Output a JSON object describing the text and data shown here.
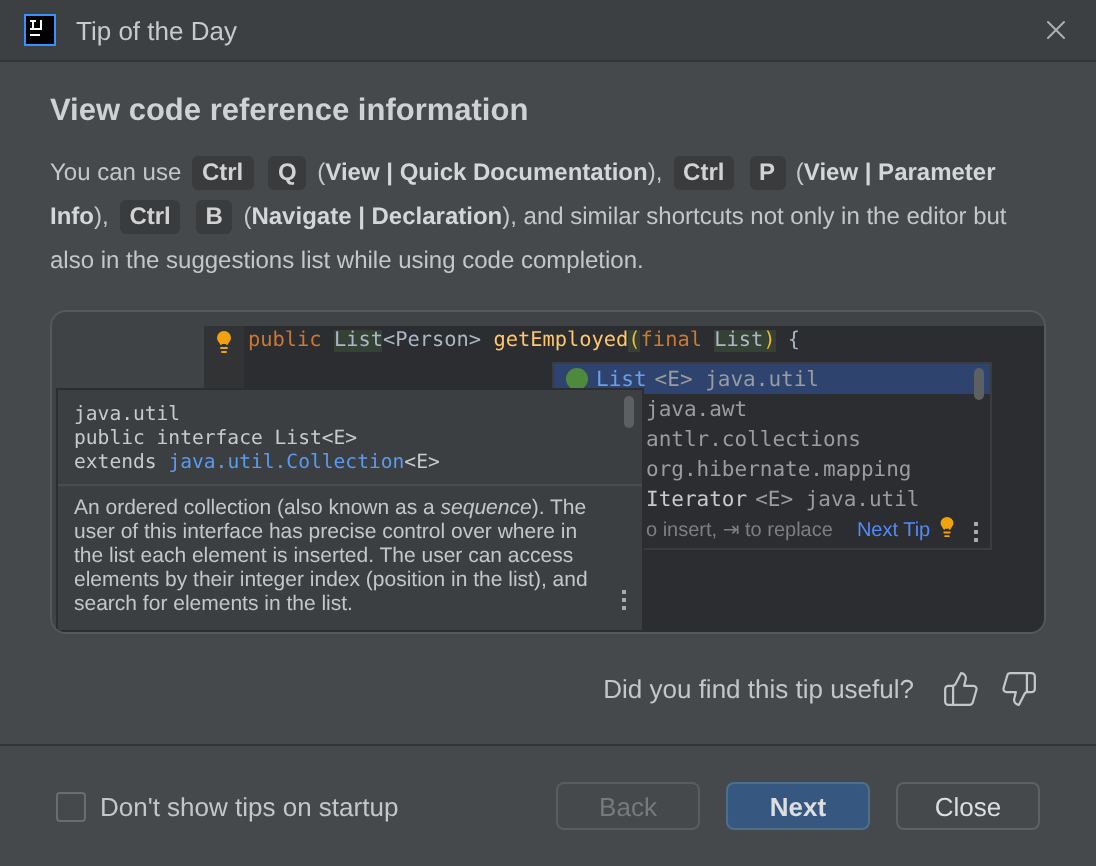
{
  "window": {
    "title": "Tip of the Day"
  },
  "tip": {
    "title": "View code reference information",
    "body": [
      {
        "kind": "text",
        "text": "You can use"
      },
      {
        "kind": "key",
        "text": "Ctrl"
      },
      {
        "kind": "key",
        "text": "Q"
      },
      {
        "kind": "text",
        "text": "(**View | Quick Documentation**),"
      },
      {
        "kind": "key",
        "text": "Ctrl"
      },
      {
        "kind": "key",
        "text": "P"
      },
      {
        "kind": "text",
        "text": "(**View | Parameter**"
      },
      {
        "kind": "text",
        "text": "**Info**),"
      },
      {
        "kind": "key",
        "text": "Ctrl"
      },
      {
        "kind": "key",
        "text": "B"
      },
      {
        "kind": "text",
        "text": "(**Navigate | Declaration**), and similar shortcuts not only in the editor but"
      },
      {
        "kind": "text",
        "text": "also in the suggestions list while using code completion."
      }
    ]
  },
  "example": {
    "code": [
      {
        "kind": "keyword",
        "text": "public "
      },
      {
        "kind": "type",
        "text": "List"
      },
      {
        "kind": "plain",
        "text": "<Person> "
      },
      {
        "kind": "method",
        "text": "getEmployed"
      },
      {
        "kind": "paren",
        "text": "("
      },
      {
        "kind": "keyword",
        "text": "final "
      },
      {
        "kind": "type",
        "text": "List"
      },
      {
        "kind": "paren",
        "text": ")"
      },
      {
        "kind": "plain",
        "text": " {"
      }
    ],
    "completion": {
      "items": [
        {
          "name": "List",
          "rest": "<E> java.util",
          "selected": true
        },
        {
          "rest": "java.awt",
          "selected": false
        },
        {
          "rest": "antlr.collections",
          "selected": false
        },
        {
          "rest": "org.hibernate.mapping",
          "selected": false
        },
        {
          "name": "Iterator",
          "rest": "<E> java.util",
          "selected": false
        }
      ],
      "hint": "o insert, ⇥ to replace",
      "link": "Next Tip"
    },
    "doc": {
      "lines": [
        "java.util",
        "public interface List<E>"
      ],
      "extends_label": "extends",
      "extends_link": "java.util.Collection",
      "extends_rest": "<E>",
      "description": "An ordered collection (also known as a *sequence*). The user of this interface has precise control over where in the list each element is inserted. The user can access elements by their integer index (position in the list), and search for elements in the list."
    }
  },
  "feedback": {
    "question": "Did you find this tip useful?"
  },
  "footer": {
    "checkbox": {
      "label": "Don't show tips on startup",
      "checked": false
    },
    "buttons": [
      {
        "label": "Back",
        "disabled": true,
        "primary": false
      },
      {
        "label": "Next",
        "disabled": false,
        "primary": true
      },
      {
        "label": "Close",
        "disabled": false,
        "primary": false
      }
    ]
  }
}
